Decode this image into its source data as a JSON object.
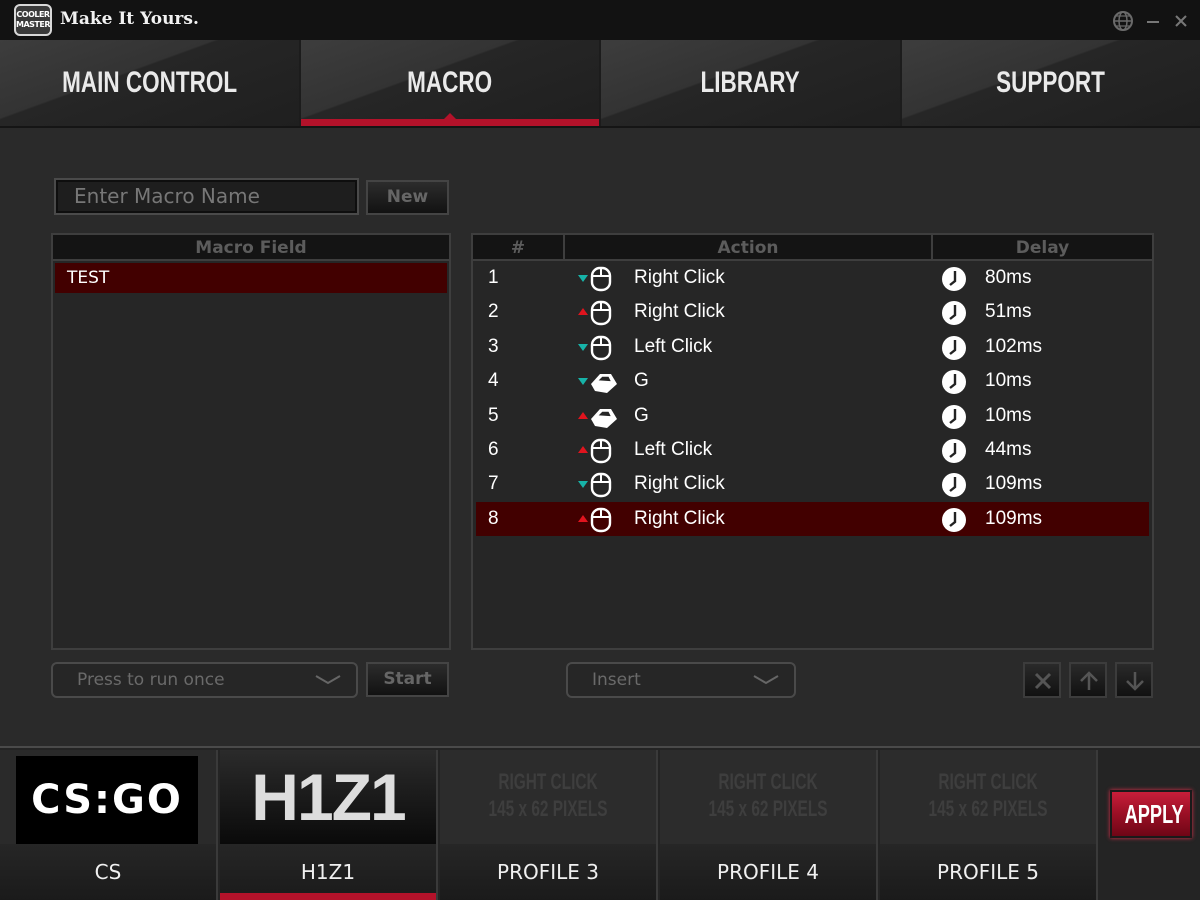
{
  "titlebar": {
    "logo_text": "COOLER MASTER",
    "brand": "Make It Yours.",
    "icons": [
      "globe-icon",
      "minimize-icon",
      "close-icon"
    ]
  },
  "main_tabs": [
    {
      "label": "MAIN CONTROL",
      "active": false
    },
    {
      "label": "MACRO",
      "active": true
    },
    {
      "label": "LIBRARY",
      "active": false
    },
    {
      "label": "SUPPORT",
      "active": false
    }
  ],
  "macro_name": {
    "placeholder": "Enter Macro Name",
    "value": "",
    "new_label": "New"
  },
  "macro_field": {
    "header": "Macro Field",
    "items": [
      {
        "name": "TEST",
        "selected": true
      }
    ]
  },
  "actions_table": {
    "headers": {
      "num": "#",
      "action": "Action",
      "delay": "Delay"
    },
    "rows": [
      {
        "num": "1",
        "direction": "down",
        "device": "mouse",
        "action": "Right Click",
        "delay": "80ms",
        "selected": false
      },
      {
        "num": "2",
        "direction": "up",
        "device": "mouse",
        "action": "Right Click",
        "delay": "51ms",
        "selected": false
      },
      {
        "num": "3",
        "direction": "down",
        "device": "mouse",
        "action": "Left Click",
        "delay": "102ms",
        "selected": false
      },
      {
        "num": "4",
        "direction": "down",
        "device": "keyboard",
        "action": "G",
        "delay": "10ms",
        "selected": false
      },
      {
        "num": "5",
        "direction": "up",
        "device": "keyboard",
        "action": "G",
        "delay": "10ms",
        "selected": false
      },
      {
        "num": "6",
        "direction": "up",
        "device": "mouse",
        "action": "Left Click",
        "delay": "44ms",
        "selected": false
      },
      {
        "num": "7",
        "direction": "down",
        "device": "mouse",
        "action": "Right Click",
        "delay": "109ms",
        "selected": false
      },
      {
        "num": "8",
        "direction": "up",
        "device": "mouse",
        "action": "Right Click",
        "delay": "109ms",
        "selected": true
      }
    ]
  },
  "run_mode": {
    "selected": "Press to run once",
    "start_label": "Start"
  },
  "insert": {
    "selected": "Insert"
  },
  "row_tools": [
    "delete-icon",
    "arrow-up-icon",
    "arrow-down-icon"
  ],
  "profiles": [
    {
      "label": "CS",
      "thumb": "CS:GO",
      "active": false
    },
    {
      "label": "H1Z1",
      "thumb": "H1Z1",
      "active": true
    },
    {
      "label": "PROFILE 3",
      "thumb_line1": "RIGHT CLICK",
      "thumb_line2": "145 x 62 PIXELS",
      "active": false
    },
    {
      "label": "PROFILE 4",
      "thumb_line1": "RIGHT CLICK",
      "thumb_line2": "145 x 62 PIXELS",
      "active": false
    },
    {
      "label": "PROFILE 5",
      "thumb_line1": "RIGHT CLICK",
      "thumb_line2": "145 x 62 PIXELS",
      "active": false
    }
  ],
  "apply_label": "APPLY",
  "colors": {
    "accent": "#b3122a",
    "selection": "#420000",
    "key_down": "#17b3a8",
    "key_up": "#e0141e"
  }
}
